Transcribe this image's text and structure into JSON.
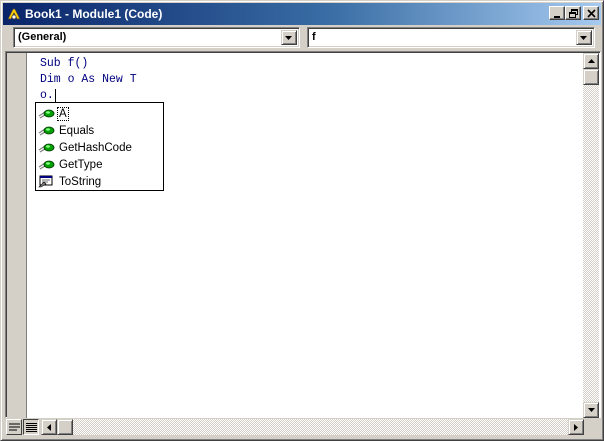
{
  "window": {
    "title": "Book1 - Module1 (Code)",
    "icon": "vba-project-icon"
  },
  "dropdowns": {
    "object": "(General)",
    "procedure": "f"
  },
  "code": {
    "lines": [
      "Sub f()",
      "Dim o As New T",
      "o."
    ]
  },
  "completion": {
    "items": [
      {
        "label": "A",
        "icon": "method-icon",
        "selected": true
      },
      {
        "label": "Equals",
        "icon": "method-icon",
        "selected": false
      },
      {
        "label": "GetHashCode",
        "icon": "method-icon",
        "selected": false
      },
      {
        "label": "GetType",
        "icon": "method-icon",
        "selected": false
      },
      {
        "label": "ToString",
        "icon": "property-icon",
        "selected": false
      }
    ]
  },
  "colors": {
    "title_start": "#0a246a",
    "title_end": "#a6caf0",
    "code_text": "#000080",
    "face": "#d4d0c8"
  }
}
